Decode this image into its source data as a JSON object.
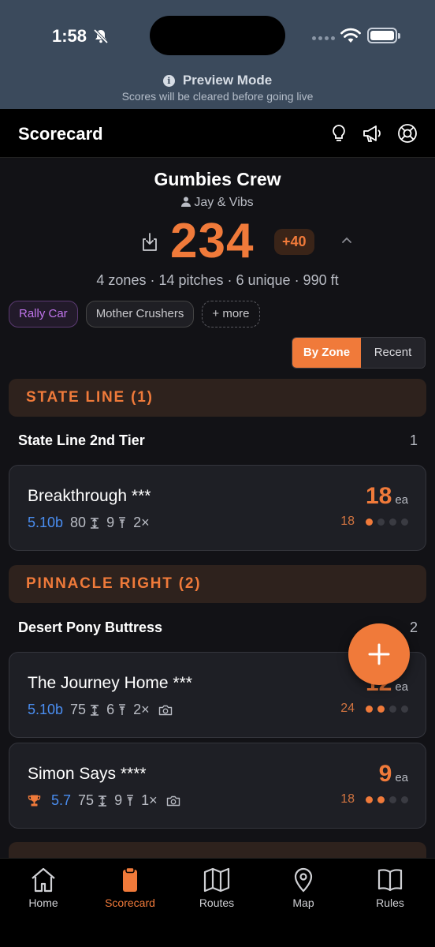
{
  "status": {
    "time": "1:58"
  },
  "preview": {
    "title": "Preview Mode",
    "subtitle": "Scores will be cleared before going live"
  },
  "header": {
    "title": "Scorecard",
    "icons": [
      "lightbulb-icon",
      "megaphone-icon",
      "lifebuoy-icon"
    ]
  },
  "team": {
    "name": "Gumbies Crew",
    "members": "Jay & Vibs",
    "score": "234",
    "delta": "+40",
    "stats": "4 zones · 14 pitches · 6 unique · 990 ft",
    "tags": [
      "Rally Car",
      "Mother Crushers"
    ],
    "more_label": "+ more"
  },
  "view_toggle": {
    "options": [
      "By Zone",
      "Recent"
    ],
    "selected": "By Zone"
  },
  "zones": [
    {
      "title": "STATE LINE (1)",
      "area": "State Line 2nd Tier",
      "area_count": "1",
      "routes": [
        {
          "name": "Breakthrough ***",
          "grade": "5.10b",
          "length": "80",
          "bolts": "9",
          "laps": "2×",
          "points": "18",
          "unit": "ea",
          "total": "18",
          "progress": 1,
          "progress_max": 4
        }
      ]
    },
    {
      "title": "PINNACLE RIGHT (2)",
      "area": "Desert Pony Buttress",
      "area_count": "2",
      "routes": [
        {
          "name": "The Journey Home ***",
          "grade": "5.10b",
          "length": "75",
          "bolts": "6",
          "laps": "2×",
          "points": "12",
          "unit": "ea",
          "total": "24",
          "progress": 2,
          "progress_max": 4
        },
        {
          "name": "Simon Says ****",
          "grade": "5.7",
          "length": "75",
          "bolts": "9",
          "laps": "1×",
          "points": "9",
          "unit": "ea",
          "total": "18",
          "progress": 2,
          "progress_max": 4
        }
      ]
    }
  ],
  "tabs": [
    {
      "label": "Home",
      "icon": "home-icon"
    },
    {
      "label": "Scorecard",
      "icon": "clipboard-icon",
      "active": true
    },
    {
      "label": "Routes",
      "icon": "map-fold-icon"
    },
    {
      "label": "Map",
      "icon": "map-pin-icon"
    },
    {
      "label": "Rules",
      "icon": "book-icon"
    }
  ],
  "colors": {
    "accent": "#f07a3a",
    "grade": "#4a8df0",
    "tag_purple": "#c074ec",
    "banner": "#3b4a5c"
  }
}
